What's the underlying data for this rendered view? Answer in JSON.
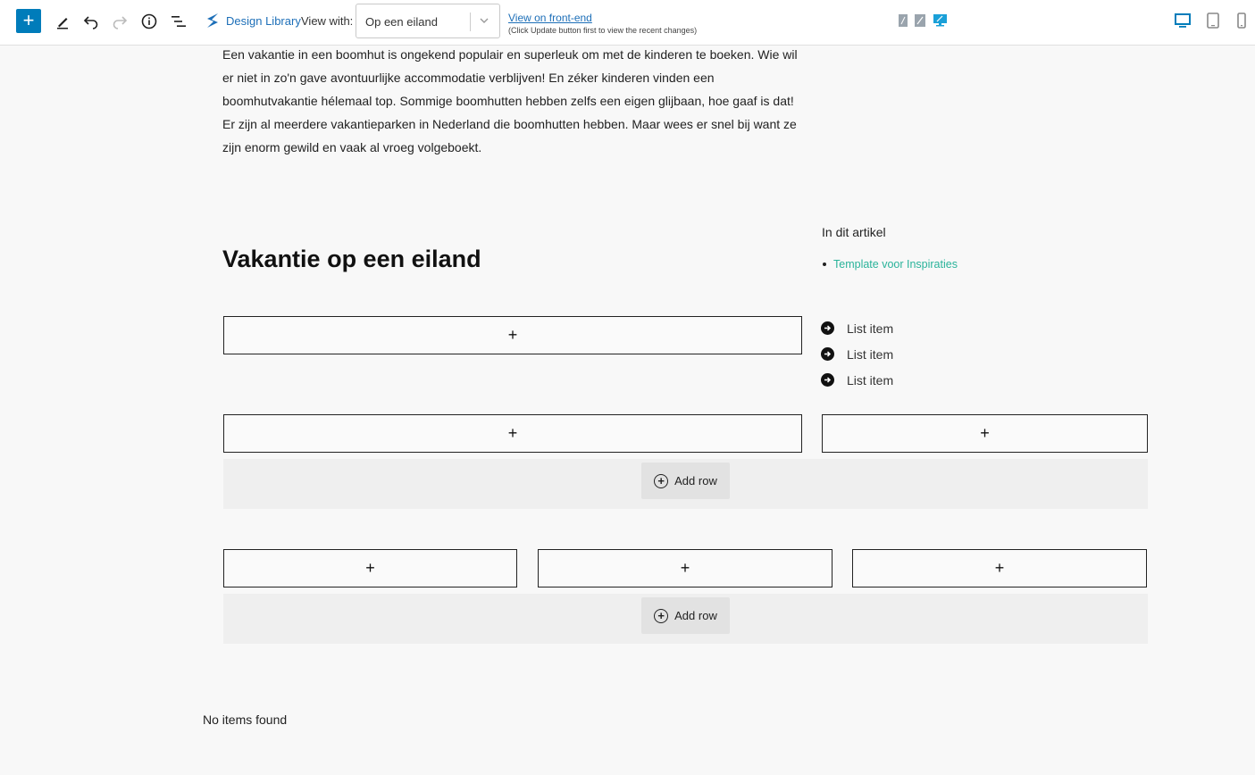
{
  "toolbar": {
    "add_label": "+",
    "design_library": "Design Library",
    "view_with_label": "View with:",
    "view_with_value": "Op een eiland",
    "frontend_link": "View on front-end",
    "frontend_hint": "(Click Update button first to view the recent changes)",
    "accent_color": "#007cba"
  },
  "content": {
    "intro": "Een vakantie in een boomhut is ongekend populair en superleuk om met de kinderen te boeken. Wie wil er niet in zo'n gave avontuurlijke accommodatie verblijven! En zéker kinderen vinden een boomhutvakantie hélemaal top. Sommige boomhutten hebben zelfs een eigen glijbaan, hoe gaaf is dat! Er zijn al meerdere vakantieparken in Nederland die boomhutten hebben. Maar wees er snel bij want ze zijn enorm gewild en vaak al vroeg volgeboekt.",
    "heading": "Vakantie op een eiland",
    "toc_title": "In dit artikel",
    "toc_items": [
      "Template voor Inspiraties"
    ],
    "toc_link_color": "#2ab39a",
    "list_items": [
      "List item",
      "List item",
      "List item"
    ],
    "placeholder_symbol": "+",
    "add_row_label": "Add row",
    "add_row_label_2": "Add row",
    "no_items": "No items found"
  }
}
